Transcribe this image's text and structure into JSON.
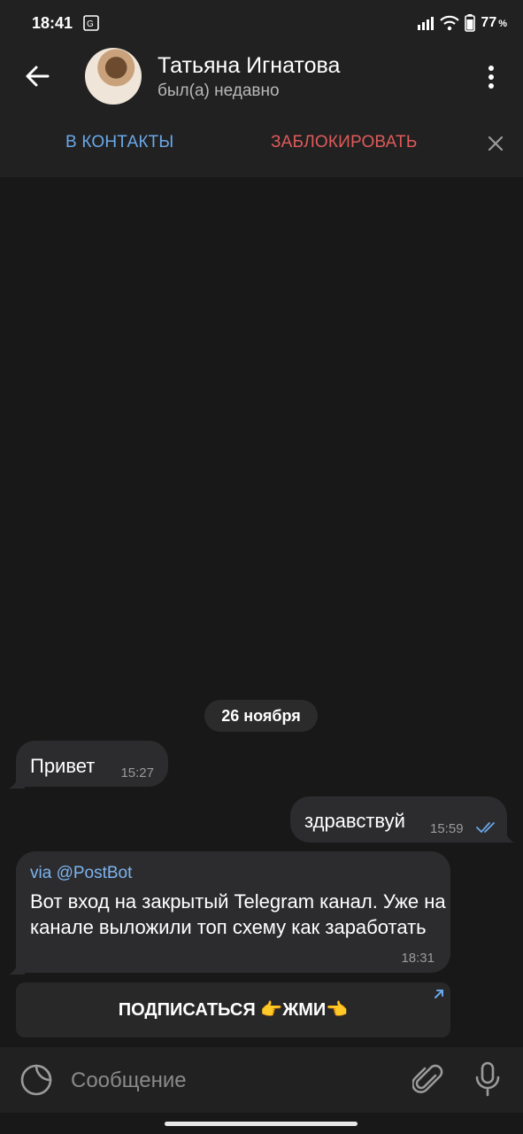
{
  "status_bar": {
    "time": "18:41",
    "battery_percent": "77",
    "battery_unit": "%"
  },
  "header": {
    "contact_name": "Татьяна Игнатова",
    "contact_status": "был(а) недавно"
  },
  "action_bar": {
    "add_contact_label": "В КОНТАКТЫ",
    "block_label": "ЗАБЛОКИРОВАТЬ",
    "colors": {
      "add": "#6aa8ea",
      "block": "#e05a5a"
    }
  },
  "chat": {
    "date_separator": "26 ноября",
    "messages": [
      {
        "direction": "in",
        "text": "Привет",
        "time": "15:27"
      },
      {
        "direction": "out",
        "text": "здравствуй",
        "time": "15:59",
        "status": "read"
      },
      {
        "direction": "in",
        "via_prefix": "via",
        "via_bot": "@PostBot",
        "text": "Вот вход на закрытый Telegram канал. Уже на канале выложили топ схему как заработать",
        "time": "18:31",
        "inline_button": "ПОДПИСАТЬСЯ 👉ЖМИ👈"
      }
    ]
  },
  "composer": {
    "placeholder": "Сообщение"
  }
}
